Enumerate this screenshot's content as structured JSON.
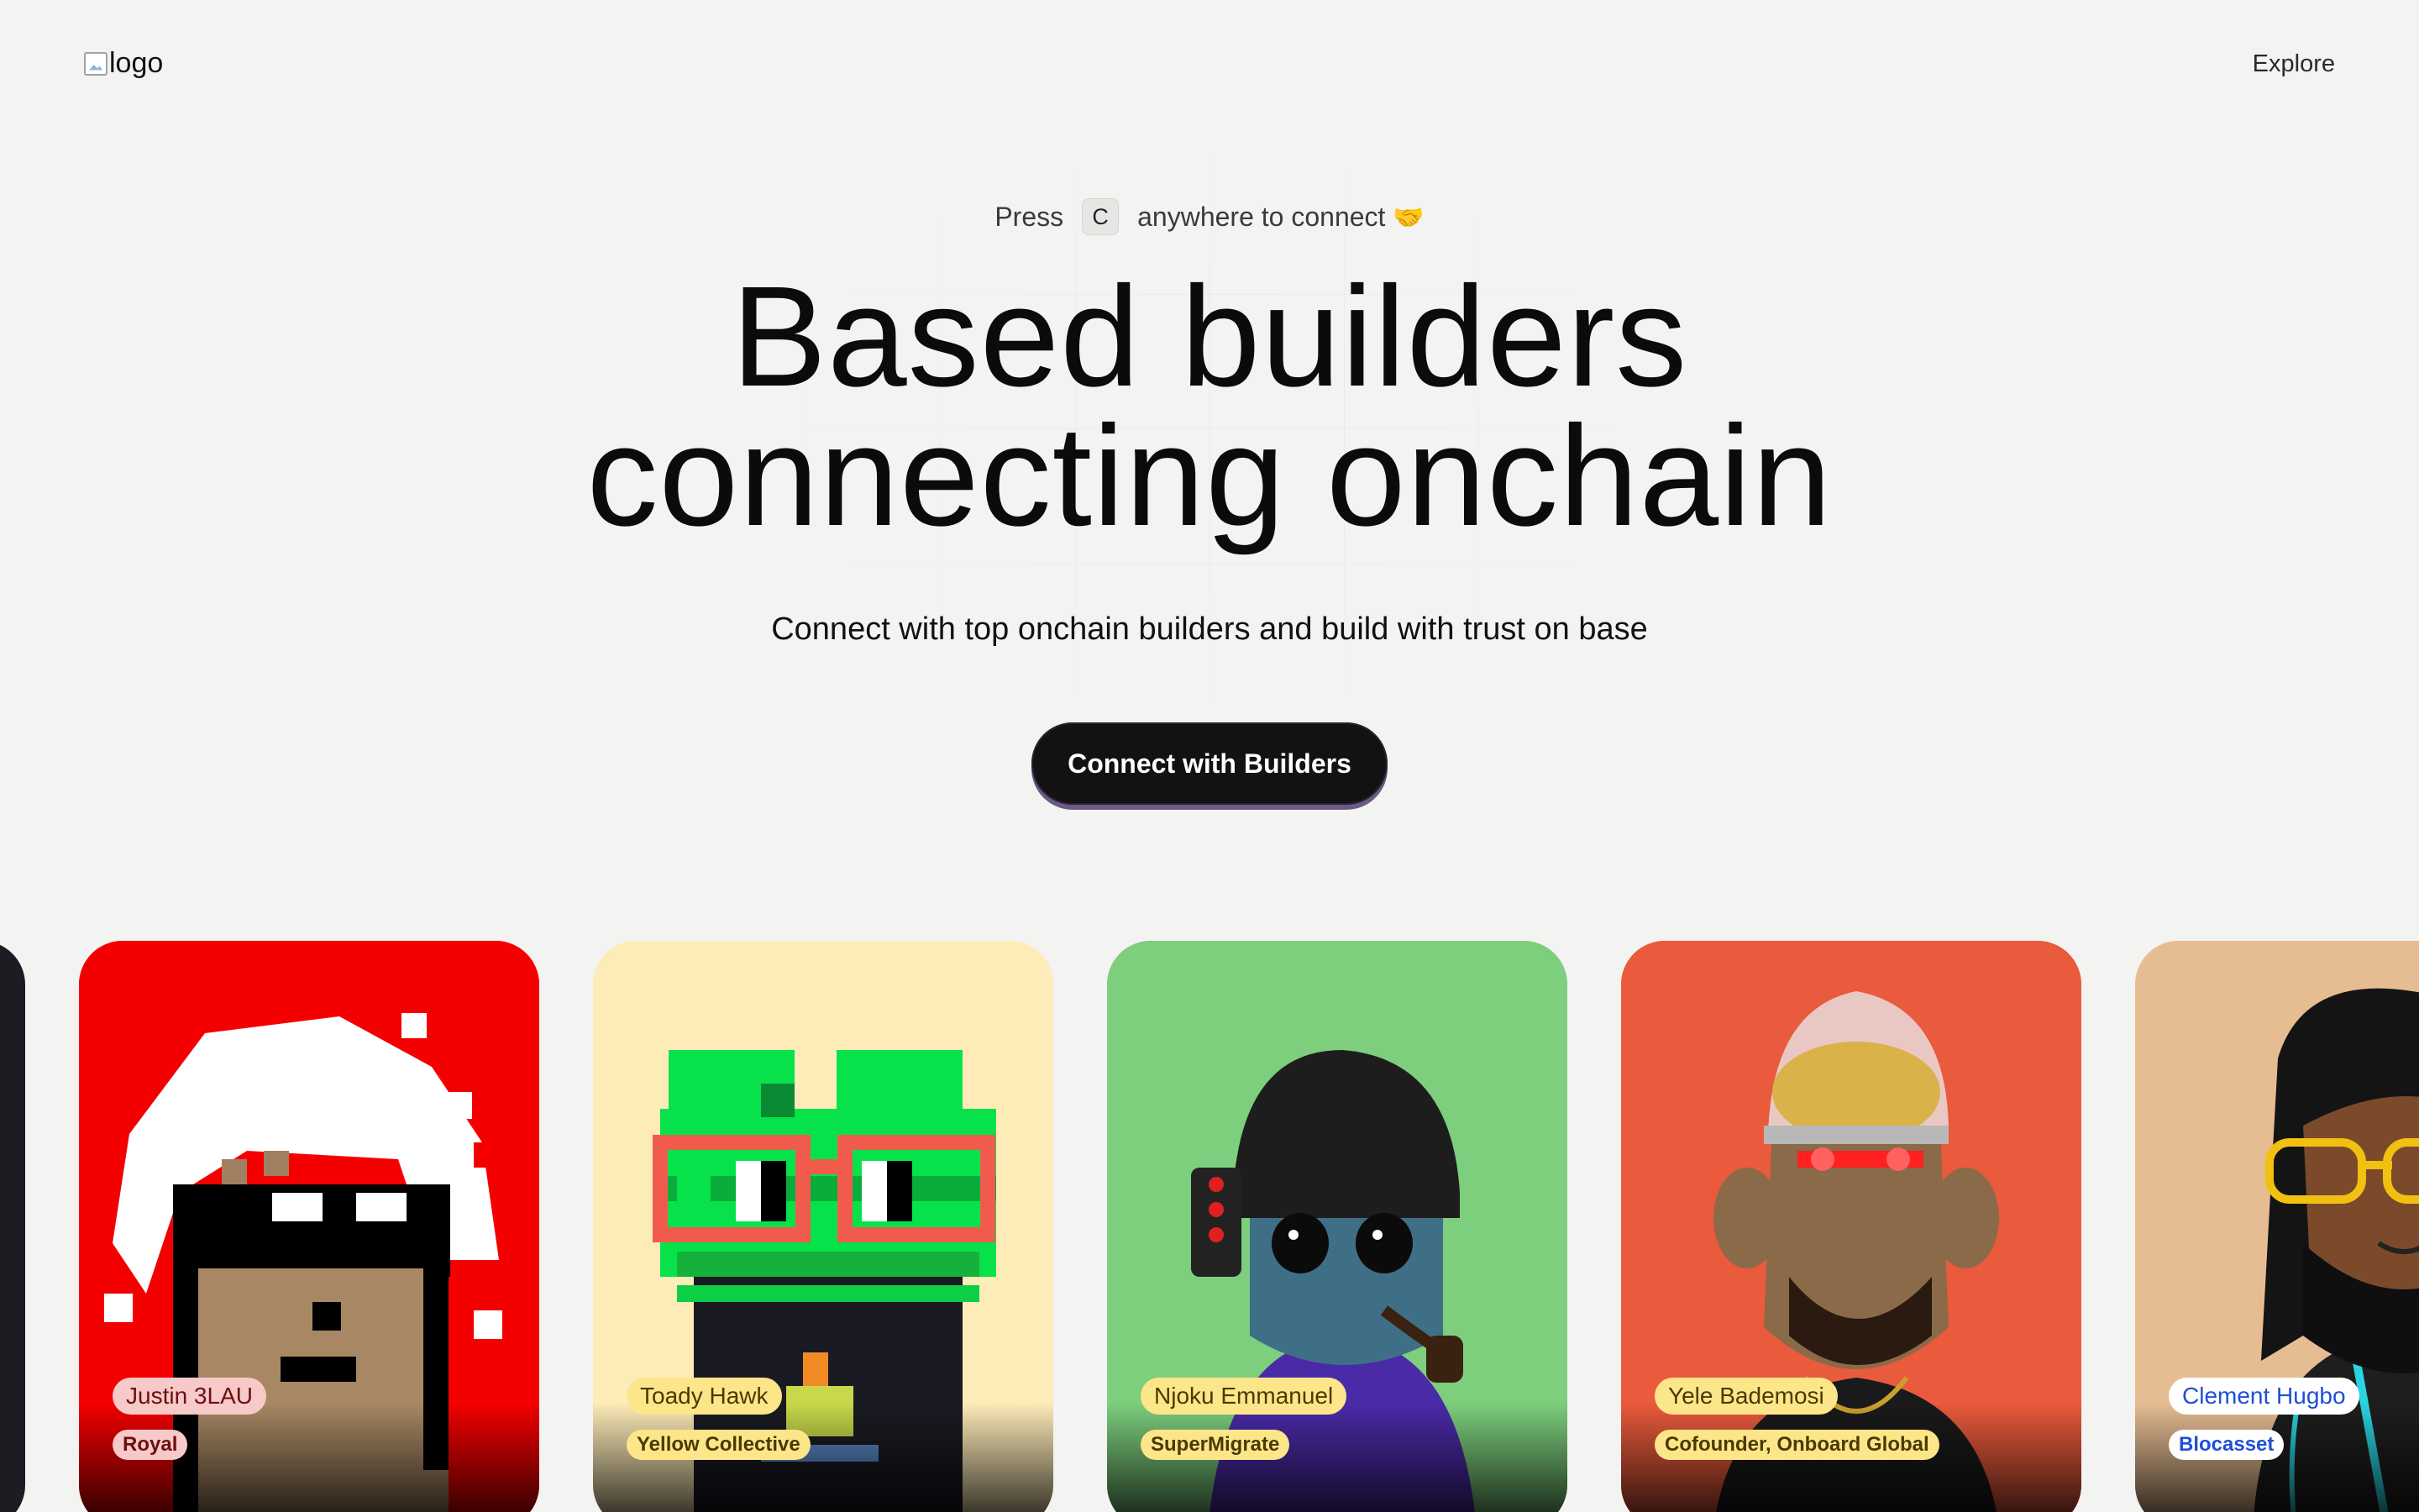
{
  "header": {
    "logo_alt": "logo",
    "nav_explore": "Explore"
  },
  "hero": {
    "press_before": "Press",
    "key": "C",
    "press_after": "anywhere to connect",
    "press_emoji": "🤝",
    "headline_line1": "Based builders",
    "headline_line2": "connecting onchain",
    "subtitle": "Connect with top onchain builders and build with trust on base",
    "cta_label": "Connect with Builders"
  },
  "builders": [
    {
      "name": "Justin 3LAU",
      "org": "Royal",
      "bg": "#f40000",
      "name_pill_bg": "#f7c9c9",
      "name_pill_color": "#6b1010",
      "org_pill_bg": "#f7c9c9",
      "org_pill_color": "#6b1010"
    },
    {
      "name": "Toady Hawk",
      "org": "Yellow Collective",
      "bg": "#fdebb8",
      "name_pill_bg": "#fde68a",
      "name_pill_color": "#4a3a00",
      "org_pill_bg": "#fde68a",
      "org_pill_color": "#4a3a00"
    },
    {
      "name": "Njoku Emmanuel",
      "org": "SuperMigrate",
      "bg": "#7dce7d",
      "name_pill_bg": "#fde68a",
      "name_pill_color": "#4a3a00",
      "org_pill_bg": "#fde68a",
      "org_pill_color": "#4a3a00"
    },
    {
      "name": "Yele Bademosi",
      "org": "Cofounder, Onboard Global",
      "bg": "#ea5a3c",
      "name_pill_bg": "#fde68a",
      "name_pill_color": "#4a3a00",
      "org_pill_bg": "#fde68a",
      "org_pill_color": "#4a3a00"
    },
    {
      "name": "Clement Hugbo",
      "org": "Blocasset",
      "bg": "#e6bd93",
      "name_pill_bg": "#ffffff",
      "name_pill_color": "#1f4fd6",
      "org_pill_bg": "#ffffff",
      "org_pill_color": "#1f4fd6"
    }
  ]
}
